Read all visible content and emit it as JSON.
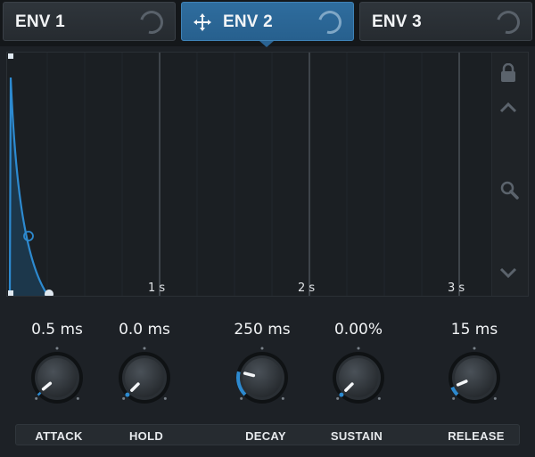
{
  "tabs": [
    {
      "label": "ENV 1",
      "active": false
    },
    {
      "label": "ENV 2",
      "active": true
    },
    {
      "label": "ENV 3",
      "active": false
    }
  ],
  "graph": {
    "time_markers": [
      "1 s",
      "2 s",
      "3 s"
    ],
    "accent_color": "#2d8ad0",
    "tools": [
      "lock-icon",
      "chevron-up-icon",
      "zoom-icon",
      "chevron-down-icon"
    ]
  },
  "knobs": [
    {
      "label": "ATTACK",
      "value": "0.5 ms",
      "position": 0.02
    },
    {
      "label": "HOLD",
      "value": "0.0 ms",
      "position": 0.0
    },
    {
      "label": "DECAY",
      "value": "250 ms",
      "position": 0.22
    },
    {
      "label": "SUSTAIN",
      "value": "0.00%",
      "position": 0.0
    },
    {
      "label": "RELEASE",
      "value": "15 ms",
      "position": 0.08
    }
  ]
}
